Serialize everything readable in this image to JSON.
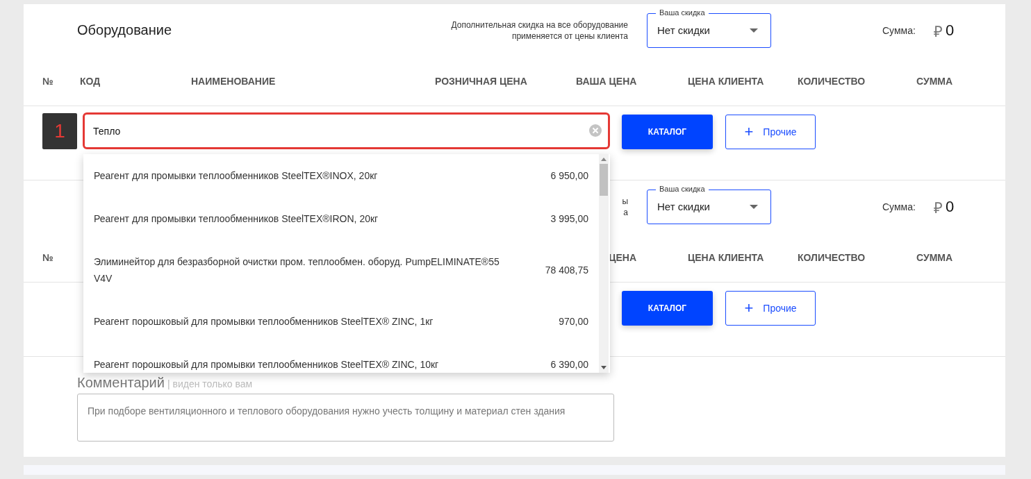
{
  "sections": [
    {
      "title": "Оборудование",
      "discount_note": [
        "Дополнительная скидка на все оборудование",
        "применяется от цены клиента"
      ],
      "discount": {
        "label": "Ваша скидка",
        "value": "Нет скидки"
      },
      "sum": {
        "label": "Сумма:",
        "currency": "₽",
        "value": "0"
      },
      "columns": [
        "№",
        "КОД",
        "НАИМЕНОВАНИЕ",
        "РОЗНИЧНАЯ ЦЕНА",
        "ВАША ЦЕНА",
        "ЦЕНА КЛИЕНТА",
        "КОЛИЧЕСТВО",
        "СУММА"
      ],
      "row": {
        "badge": "1",
        "search": {
          "value": "Тепло"
        },
        "catalog_button": "КАТАЛОГ",
        "other_button": {
          "icon": "+",
          "label": "Прочие"
        }
      }
    },
    {
      "discount_note": [
        "ы",
        "а"
      ],
      "discount": {
        "label": "Ваша скидка",
        "value": "Нет скидки"
      },
      "sum": {
        "label": "Сумма:",
        "currency": "₽",
        "value": "0"
      },
      "columns": [
        "№",
        null,
        null,
        null,
        "ЦЕНА",
        "ЦЕНА КЛИЕНТА",
        "КОЛИЧЕСТВО",
        "СУММА"
      ],
      "row": {
        "catalog_button": "КАТАЛОГ",
        "other_button": {
          "icon": "+",
          "label": "Прочие"
        }
      }
    }
  ],
  "comments": {
    "title": "Комментарий",
    "hint": "| виден только вам",
    "placeholder": "При подборе вентиляционного и теплового оборудования нужно учесть толщину и материал стен здания"
  },
  "suggestions": [
    {
      "name": "Реагент для промывки теплообменников SteelTEX®INOX, 20кг",
      "price": "6 950,00"
    },
    {
      "name": "Реагент для промывки теплообменников SteelTEX®IRON, 20кг",
      "price": "3 995,00"
    },
    {
      "name": "Элиминейтор для безразборной очистки пром. теплообмен. оборуд. PumpELIMINATE®55 V4V",
      "price": "78 408,75"
    },
    {
      "name": "Реагент порошковый для промывки теплообменников SteelTEX® ZINC, 1кг",
      "price": "970,00"
    },
    {
      "name": "Реагент порошковый для промывки теплообменников SteelTEX® ZINC, 10кг",
      "price": "6 390,00"
    }
  ]
}
